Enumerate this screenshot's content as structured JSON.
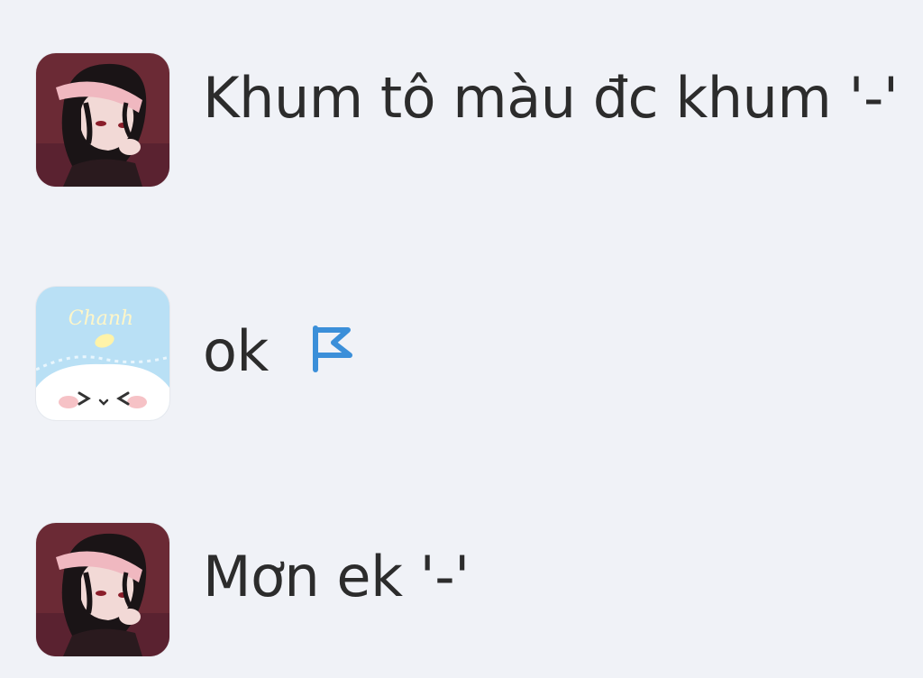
{
  "messages": [
    {
      "avatar": "dark-haired-character-avatar",
      "text": "Khum tô màu đc khum '-'"
    },
    {
      "avatar": "chanh-cute-face-avatar",
      "avatar_label": "Chanh",
      "text": "ok",
      "reaction_icon": "flag-icon"
    },
    {
      "avatar": "dark-haired-character-avatar",
      "text": "Mơn ek '-'"
    }
  ],
  "colors": {
    "background": "#f0f2f7",
    "text": "#2c2c2c",
    "flag": "#3b8fd9",
    "avatar_dark_bg": "#6b2a35",
    "avatar_light_bg": "#b9e0f5"
  }
}
